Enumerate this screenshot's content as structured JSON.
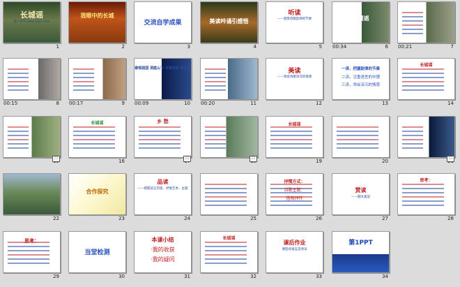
{
  "slides": [
    {
      "n": "1",
      "time": "",
      "title": "长城谣",
      "sub": "第一PPT www.1ppt.com"
    },
    {
      "n": "2",
      "time": "",
      "title": "我眼中的长城"
    },
    {
      "n": "3",
      "time": "",
      "title": "交流自学成果"
    },
    {
      "n": "4",
      "time": "",
      "title": "美读吟诵引感悟"
    },
    {
      "n": "5",
      "time": "",
      "title": "听读",
      "sub": "——感受诗歌韵律的节奏"
    },
    {
      "n": "6",
      "time": "00:34",
      "title": "长城谣"
    },
    {
      "n": "7",
      "time": "00:21",
      "title": ""
    },
    {
      "n": "8",
      "time": "00:15",
      "title": ""
    },
    {
      "n": "9",
      "time": "00:17",
      "title": ""
    },
    {
      "n": "10",
      "time": "00:09",
      "title": "歌唱祖国 洞庭山下 今宵月色 夜茫茫"
    },
    {
      "n": "11",
      "time": "00:20",
      "title": ""
    },
    {
      "n": "12",
      "time": "",
      "title": "美读",
      "sub": "——领会诗歌深沉的情感"
    },
    {
      "n": "13",
      "time": "",
      "title": "一读，把握韵律的节奏",
      "l2": "二读，注重语言的中理",
      "l3": "三读，领会深沉的情感"
    },
    {
      "n": "14",
      "time": "",
      "title": "长城谣"
    },
    {
      "n": "15",
      "time": "",
      "title": ""
    },
    {
      "n": "16",
      "time": "",
      "title": "长城谣"
    },
    {
      "n": "17",
      "time": "",
      "title": "乡 愁"
    },
    {
      "n": "18",
      "time": "",
      "title": ""
    },
    {
      "n": "19",
      "time": "",
      "title": "长城谣"
    },
    {
      "n": "20",
      "time": "",
      "title": ""
    },
    {
      "n": "21",
      "time": "",
      "title": ""
    },
    {
      "n": "22",
      "time": "",
      "title": ""
    },
    {
      "n": "23",
      "time": "",
      "title": "合作探究"
    },
    {
      "n": "24",
      "time": "",
      "title": "品读",
      "sub": "——把握语言内容、抒情艺术、主题"
    },
    {
      "n": "25",
      "time": "",
      "title": ""
    },
    {
      "n": "26",
      "time": "",
      "title": "抒情方式：",
      "l2": "诗歌主题：",
      "l3": "借物抒怀"
    },
    {
      "n": "27",
      "time": "",
      "title": "赏读",
      "sub": "——群文类读"
    },
    {
      "n": "28",
      "time": "",
      "title": "思考："
    },
    {
      "n": "29",
      "time": "",
      "title": "思考："
    },
    {
      "n": "30",
      "time": "",
      "title": "当堂检测"
    },
    {
      "n": "31",
      "time": "",
      "title": "本课小结",
      "l2": "·我的收获",
      "l3": "·我的疑问"
    },
    {
      "n": "32",
      "time": "",
      "title": "长城谣"
    },
    {
      "n": "33",
      "time": "",
      "title": "课后作业",
      "sub": "课后背诵五首诗词"
    },
    {
      "n": "34",
      "time": "",
      "title": "第1PPT"
    }
  ]
}
